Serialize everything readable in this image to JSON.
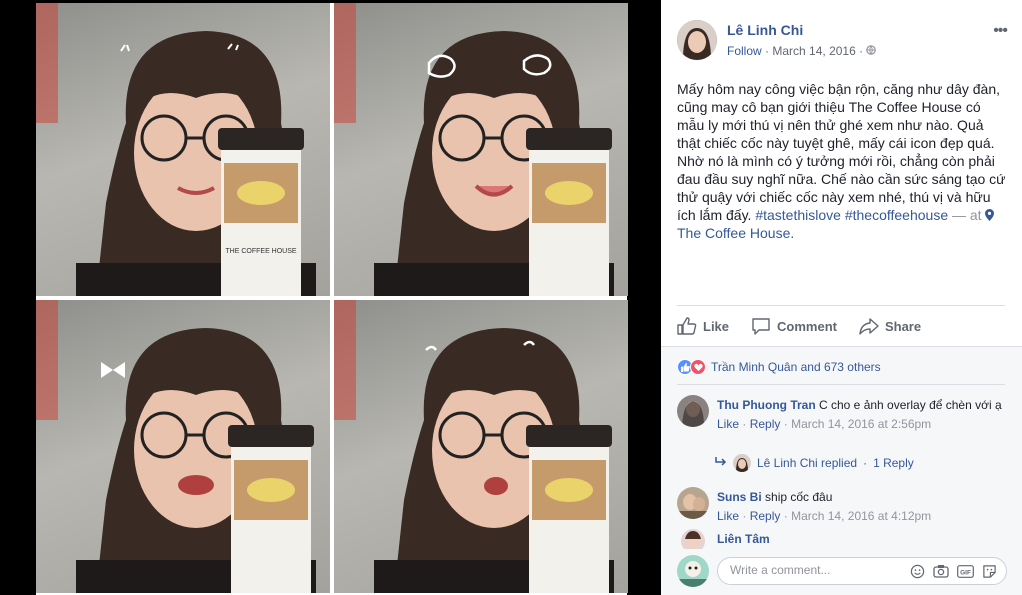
{
  "post": {
    "author": "Lê Linh Chi",
    "follow_label": "Follow",
    "date": "March 14, 2016",
    "privacy_icon": "globe-icon",
    "more_icon": "more-options-icon",
    "text_body": "Mấy hôm nay công việc bận rộn, căng như dây đàn, cũng may cô bạn giới thiệu The Coffee House có mẫu ly mới thú vị nên thử ghé xem như nào. Quả thật chiếc cốc này tuyệt ghê, mấy cái icon đẹp quá. Nhờ nó là mình có ý tưởng mới rồi, chẳng còn phải đau đầu suy nghĩ nữa. Chế nào cần sức sáng tạo cứ thử quậy với chiếc cốc này xem nhé, thú vị và hữu ích lắm đấy.",
    "hashtag_1": "#tastethislove",
    "hashtag_2": "#thecoffeehouse",
    "at_prefix": "— at",
    "place": "The Coffee House.",
    "cup_text": "THE COFFEE HOUSE"
  },
  "actions": {
    "like": "Like",
    "comment": "Comment",
    "share": "Share"
  },
  "reactions": {
    "summary": "Trần Minh Quân and 673 others"
  },
  "comments": [
    {
      "name": "Thu Phuong Tran",
      "text": "C cho e ảnh overlay để chèn với ạ",
      "like": "Like",
      "reply": "Reply",
      "time": "March 14, 2016 at 2:56pm"
    },
    {
      "name": "Suns Bi",
      "text": "ship cốc đâu",
      "like": "Like",
      "reply": "Reply",
      "time": "March 14, 2016 at 4:12pm"
    },
    {
      "name": "Liên Tâm",
      "text": ""
    }
  ],
  "reply_summary": {
    "text": "Lê Linh Chi replied",
    "count": "1 Reply"
  },
  "write_comment": {
    "placeholder": "Write a comment..."
  },
  "separators": {
    "dot": "·"
  },
  "colors": {
    "link": "#365899",
    "like_blue": "#5890ff",
    "love_red": "#f25268"
  }
}
